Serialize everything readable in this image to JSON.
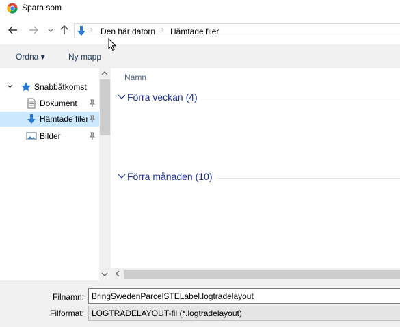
{
  "window": {
    "title": "Spara som"
  },
  "nav": {
    "back_icon": "arrow-left",
    "forward_icon": "arrow-right",
    "recent_icon": "chevron-down",
    "up_icon": "arrow-up",
    "breadcrumb": [
      "Den här datorn",
      "Hämtade filer"
    ]
  },
  "toolbar": {
    "organize_label": "Ordna ▾",
    "new_folder_label": "Ny mapp"
  },
  "sidebar": {
    "items": [
      {
        "label": "Snabbåtkomst",
        "icon": "star-icon"
      },
      {
        "label": "Dokument",
        "icon": "document-icon",
        "pinned": true
      },
      {
        "label": "Hämtade filer",
        "icon": "download-icon",
        "pinned": true,
        "selected": true
      },
      {
        "label": "Bilder",
        "icon": "pictures-icon",
        "pinned": true
      }
    ]
  },
  "content": {
    "column_header": "Namn",
    "groups": [
      {
        "label": "Förra veckan (4)"
      },
      {
        "label": "Förra månaden (10)"
      }
    ]
  },
  "form": {
    "filename_label": "Filnamn:",
    "filename_value": "BringSwedenParcelSTELabel.logtradelayout",
    "filetype_label": "Filformat:",
    "filetype_value": "LOGTRADELAYOUT-fil (*.logtradelayout)"
  },
  "colors": {
    "accent": "#1e3287",
    "selection": "#cce8ff",
    "panel": "#f0f0f0"
  }
}
